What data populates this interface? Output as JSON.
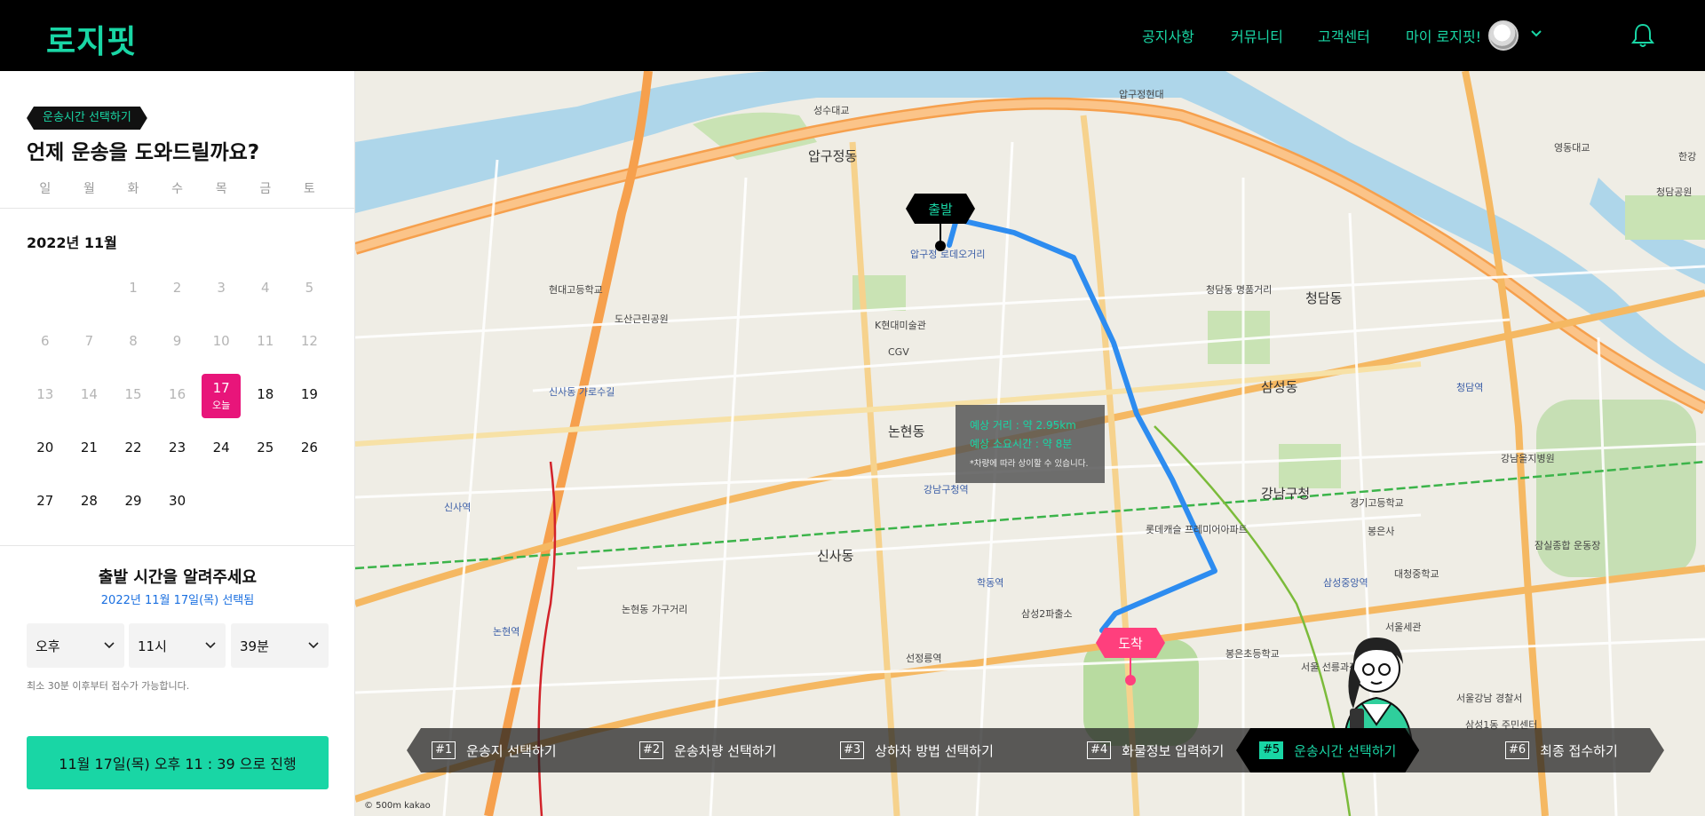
{
  "header": {
    "logo": "로지핏",
    "nav": {
      "notice": "공지사항",
      "community": "커뮤니티",
      "customer_center": "고객센터",
      "my": "마이 로지핏!"
    }
  },
  "sidebar": {
    "step_tag": "운송시간 선택하기",
    "title": "언제 운송을 도와드릴까요?",
    "weekdays": [
      "일",
      "월",
      "화",
      "수",
      "목",
      "금",
      "토"
    ],
    "month_label": "2022년 11월",
    "weeks": [
      [
        {
          "d": "",
          "state": "empty"
        },
        {
          "d": "",
          "state": "empty"
        },
        {
          "d": "1",
          "state": "past"
        },
        {
          "d": "2",
          "state": "past"
        },
        {
          "d": "3",
          "state": "past"
        },
        {
          "d": "4",
          "state": "past"
        },
        {
          "d": "5",
          "state": "past"
        }
      ],
      [
        {
          "d": "6",
          "state": "past"
        },
        {
          "d": "7",
          "state": "past"
        },
        {
          "d": "8",
          "state": "past"
        },
        {
          "d": "9",
          "state": "past"
        },
        {
          "d": "10",
          "state": "past"
        },
        {
          "d": "11",
          "state": "past"
        },
        {
          "d": "12",
          "state": "past"
        }
      ],
      [
        {
          "d": "13",
          "state": "past"
        },
        {
          "d": "14",
          "state": "past"
        },
        {
          "d": "15",
          "state": "past"
        },
        {
          "d": "16",
          "state": "past"
        },
        {
          "d": "17",
          "state": "selected",
          "today": "오늘"
        },
        {
          "d": "18",
          "state": "normal"
        },
        {
          "d": "19",
          "state": "normal"
        }
      ],
      [
        {
          "d": "20",
          "state": "normal"
        },
        {
          "d": "21",
          "state": "normal"
        },
        {
          "d": "22",
          "state": "normal"
        },
        {
          "d": "23",
          "state": "normal"
        },
        {
          "d": "24",
          "state": "normal"
        },
        {
          "d": "25",
          "state": "normal"
        },
        {
          "d": "26",
          "state": "normal"
        }
      ],
      [
        {
          "d": "27",
          "state": "normal"
        },
        {
          "d": "28",
          "state": "normal"
        },
        {
          "d": "29",
          "state": "normal"
        },
        {
          "d": "30",
          "state": "normal"
        },
        {
          "d": "",
          "state": "empty"
        },
        {
          "d": "",
          "state": "empty"
        },
        {
          "d": "",
          "state": "empty"
        }
      ]
    ],
    "departure_title": "출발 시간을 알려주세요",
    "selected_date_text": "2022년 11월 17일(목) 선택됨",
    "ampm": "오후",
    "hour": "11시",
    "minute": "39분",
    "note": "최소 30분 이후부터 접수가 가능합니다.",
    "proceed_button": "11월 17일(목) 오후 11 : 39 으로 진행"
  },
  "map": {
    "start_label": "출발",
    "end_label": "도착",
    "info": {
      "distance": "예상 거리 : 약 2.95km",
      "duration": "예상 소요시간 : 약 8분",
      "disclaimer": "*차량에 따라 상이할 수 있습니다."
    },
    "scale_text": "© 500m  kakao",
    "places": [
      "압구정동",
      "신사동",
      "청담동",
      "논현동",
      "삼성동",
      "강남구청",
      "서울 선릉과정릉",
      "선정릉역",
      "압구정 로데오거리",
      "신사역",
      "논현역",
      "학동역",
      "강남구청역",
      "청담역",
      "삼성중앙역",
      "서울세관",
      "도산근린공원",
      "현대고등학교",
      "K현대미술관",
      "CGV",
      "롯데캐슬 프레미어아파트",
      "신사동 가로수길",
      "영동대교",
      "성수대교",
      "잠실종합 운동장",
      "봉은사",
      "청담공원",
      "경기고등학교",
      "대청중학교",
      "강남을지병원",
      "서울강남 경찰서",
      "논현동 가구거리",
      "압구정현대",
      "한강",
      "삼성1동 주민센터",
      "청담동 명품거리",
      "봉은초등학교",
      "삼성2파출소"
    ],
    "route_color": "#2d8cf0",
    "accent_color": "#19d6a5",
    "end_color": "#ff3f7d"
  },
  "steps": [
    {
      "num": "#1",
      "label": "운송지 선택하기",
      "active": false
    },
    {
      "num": "#2",
      "label": "운송차량 선택하기",
      "active": false
    },
    {
      "num": "#3",
      "label": "상하차 방법 선택하기",
      "active": false
    },
    {
      "num": "#4",
      "label": "화물정보 입력하기",
      "active": false
    },
    {
      "num": "#5",
      "label": "운송시간 선택하기",
      "active": true
    },
    {
      "num": "#6",
      "label": "최종 접수하기",
      "active": false
    }
  ]
}
